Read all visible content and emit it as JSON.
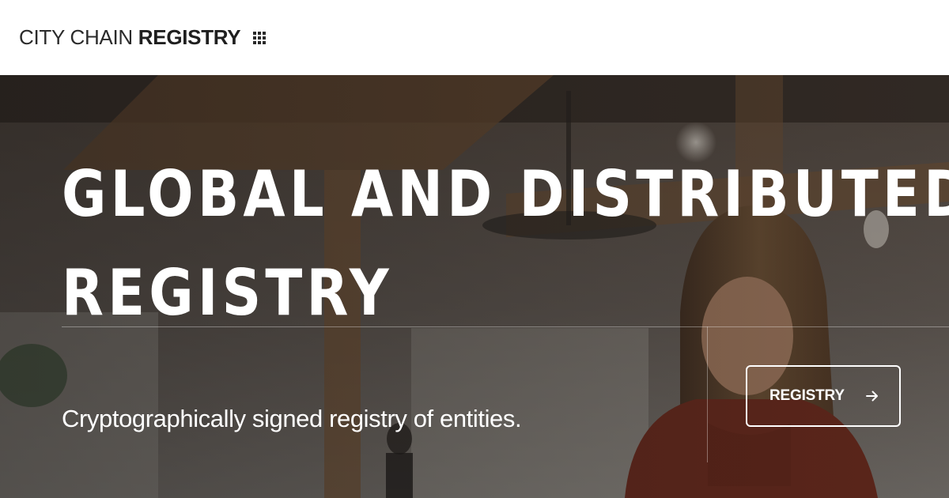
{
  "header": {
    "logo": {
      "light_text": "CITY CHAIN ",
      "bold_text": "REGISTRY",
      "icon": "grid-menu-icon"
    }
  },
  "hero": {
    "headline_line1": "GLOBAL AND DISTRIBUTED",
    "headline_line2": "REGISTRY",
    "subtitle": "Cryptographically signed registry of entities.",
    "cta": {
      "label": "REGISTRY",
      "icon": "arrow-right-icon"
    },
    "background": "office-photo-woman-smiling"
  },
  "colors": {
    "header_bg": "#ffffff",
    "logo_text": "#1f1f1f",
    "hero_text": "#ffffff",
    "overlay": "#141211"
  }
}
